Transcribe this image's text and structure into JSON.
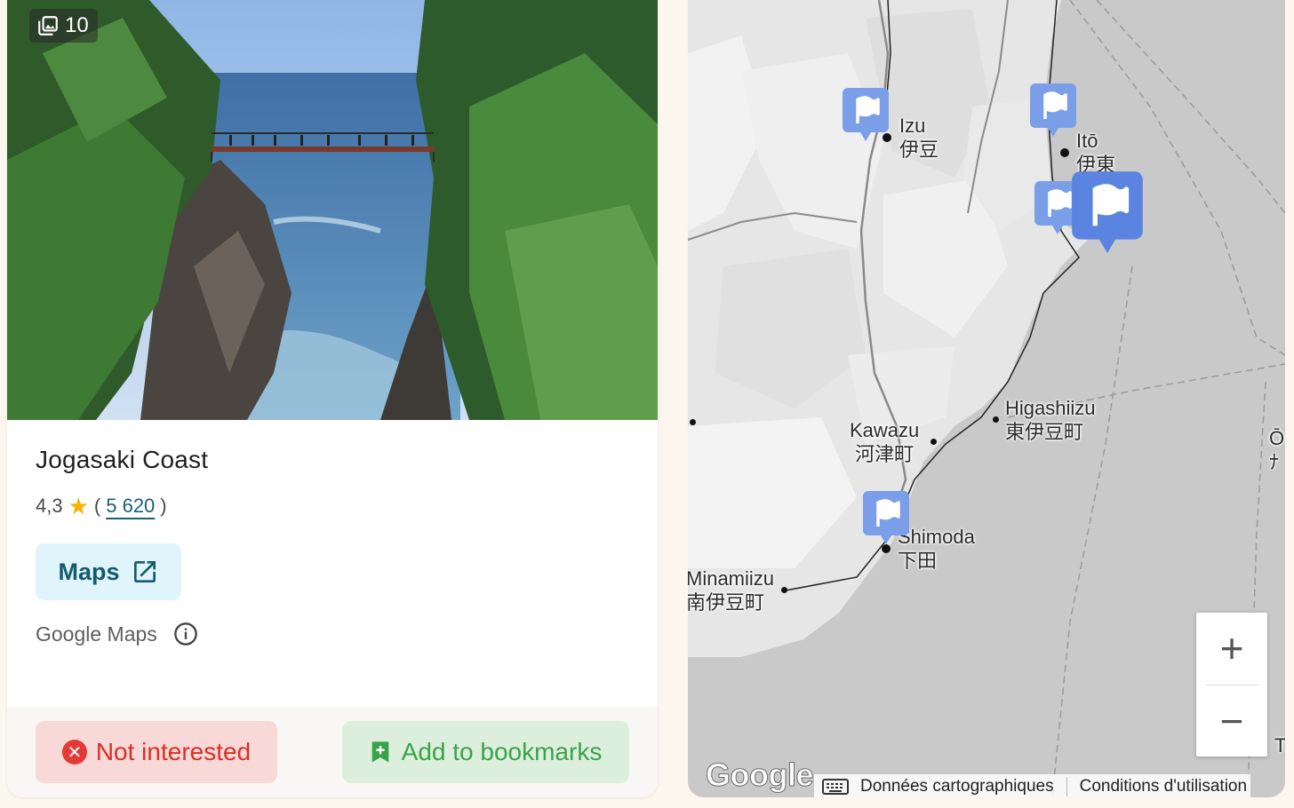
{
  "card": {
    "photo_count": "10",
    "title": "Jogasaki Coast",
    "rating": "4,3",
    "star_icon": "star-icon",
    "review_open": "(",
    "review_count": "5 620",
    "review_close": ")",
    "maps_button_label": "Maps",
    "source_label": "Google Maps",
    "not_interested_label": "Not interested",
    "add_bookmark_label": "Add to bookmarks"
  },
  "map": {
    "places": [
      {
        "name": "Izu",
        "native": "伊豆"
      },
      {
        "name": "Itō",
        "native": "伊東"
      },
      {
        "name": "Higashiizu",
        "native": "東伊豆町"
      },
      {
        "name": "Kawazu",
        "native": "河津町"
      },
      {
        "name": "Shimoda",
        "native": "下田"
      },
      {
        "name": "Minamiizu",
        "native": "南伊豆町"
      }
    ],
    "edge_labels": [
      "Ō",
      "ﾅ",
      "T"
    ],
    "zoom_in": "+",
    "zoom_out": "−",
    "logo": "Google",
    "attribution_data": "Données cartographiques",
    "attribution_terms": "Conditions d'utilisation"
  },
  "colors": {
    "accent_blue": "#5b84e0",
    "map_land": "#e8e8e8",
    "map_sea": "#c9c9c9",
    "not_interested_bg": "#f9d8d8",
    "bookmark_bg": "#dcefdc"
  }
}
